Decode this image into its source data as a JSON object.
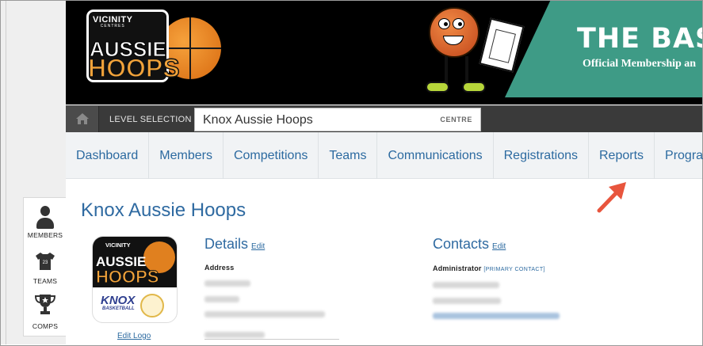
{
  "header": {
    "logo_vicinity": "VICINITY",
    "logo_centres": "CENTRES",
    "logo_aussie": "AUSSIE",
    "logo_hoops": "HOOPS",
    "banner_title": "THE BASKE",
    "banner_subtitle": "Official Membership an"
  },
  "level_bar": {
    "label": "LEVEL SELECTION",
    "value": "Knox Aussie Hoops",
    "type": "CENTRE"
  },
  "nav": {
    "items": [
      "Dashboard",
      "Members",
      "Competitions",
      "Teams",
      "Communications",
      "Registrations",
      "Reports",
      "Programs"
    ]
  },
  "sidebar": {
    "members": "MEMBERS",
    "teams": "TEAMS",
    "team_number": "23",
    "comps": "COMPS"
  },
  "page": {
    "title": "Knox Aussie Hoops",
    "edit_logo": "Edit Logo",
    "club_logo": {
      "vicinity": "VICINITY",
      "aussie": "AUSSIE",
      "hoops": "HOOPS",
      "knox": "KNOX",
      "knox_sub": "BASKETBALL"
    }
  },
  "details": {
    "title": "Details",
    "edit": "Edit",
    "address_label": "Address"
  },
  "contacts": {
    "title": "Contacts",
    "edit": "Edit",
    "admin_label": "Administrator",
    "admin_tag": "[PRIMARY CONTACT]"
  },
  "colors": {
    "link_blue": "#2c6aa0",
    "title_blue": "#2f6aa1",
    "header_black": "#000000",
    "banner_green": "#3e9b86",
    "level_bar": "#3a3a3a",
    "arrow_red": "#e8553d"
  }
}
